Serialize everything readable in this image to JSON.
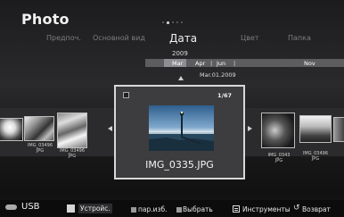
{
  "header": {
    "title": "Photo"
  },
  "tabs": [
    "Предпоч.",
    "Основной вид",
    "Дата",
    "Цвет",
    "Папка"
  ],
  "active_tab": "Дата",
  "timeline": {
    "year": "2009",
    "items": [
      "Mar",
      "Apr",
      "Jun",
      "Nov"
    ],
    "selected": "Mar",
    "current_date": "Mar.01.2009"
  },
  "focused": {
    "counter": "1/67",
    "filename": "IMG_0335.JPG"
  },
  "thumbnails_left": [
    {
      "caption_line1": "IMG_03496",
      "caption_line2": "JPG"
    },
    {
      "caption_line1": "IMG_03496",
      "caption_line2": "JPG"
    }
  ],
  "thumbnails_right": [
    {
      "caption_line1": "IMG_0343",
      "caption_line2": "JPG"
    },
    {
      "caption_line1": "IMG_03496",
      "caption_line2": "JPG"
    }
  ],
  "bottom_bar": {
    "source": "USB",
    "device_label": "Устройс.",
    "hints": [
      "пар.изб.",
      "Выбрать",
      "Инструменты",
      "Возврат"
    ]
  },
  "colors": {
    "background": "#1e1e20",
    "timeline_bar": "#5d5d60",
    "timeline_selected": "#8e8e92",
    "focus_border": "#d8d8d8"
  },
  "icons": {
    "usb": "usb-drive-icon",
    "tools": "tools-icon",
    "return": "return-icon"
  }
}
